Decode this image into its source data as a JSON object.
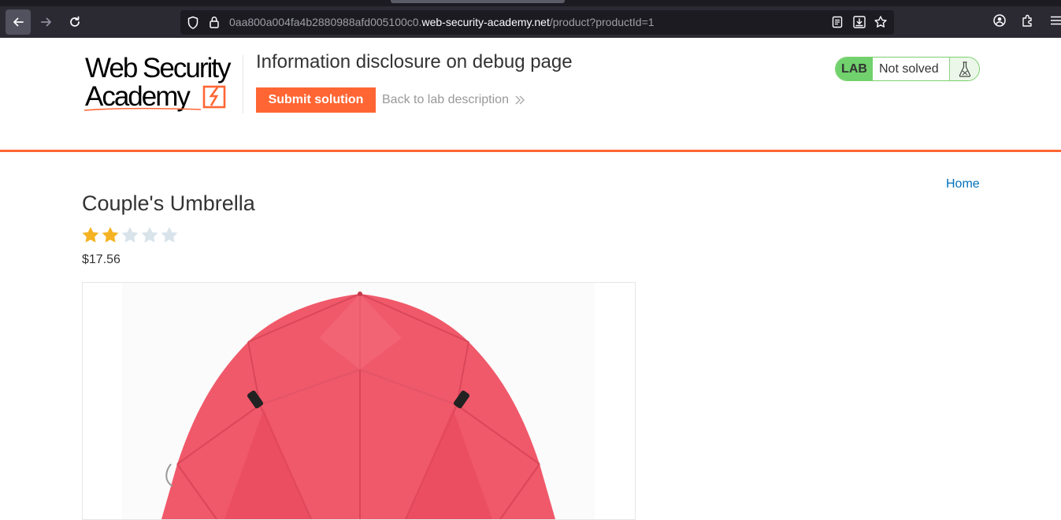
{
  "browser": {
    "url_prefix": "0aa800a004fa4b2880988afd005100c0.",
    "url_host": "web-security-academy.net",
    "url_path": "/product?productId=1"
  },
  "header": {
    "logo_line1": "Web Security",
    "logo_line2": "Academy",
    "lab_title": "Information disclosure on debug page",
    "submit_label": "Submit solution",
    "back_label": "Back to lab description",
    "lab_badge": "LAB",
    "lab_status": "Not solved"
  },
  "nav": {
    "home_label": "Home"
  },
  "product": {
    "title": "Couple's Umbrella",
    "rating": 2,
    "rating_max": 5,
    "price": "$17.56"
  },
  "colors": {
    "accent": "#ff6633",
    "link": "#0071bc",
    "star_on": "#f5b323",
    "star_off": "#d9e3ea",
    "lab_green": "#70d16d"
  }
}
